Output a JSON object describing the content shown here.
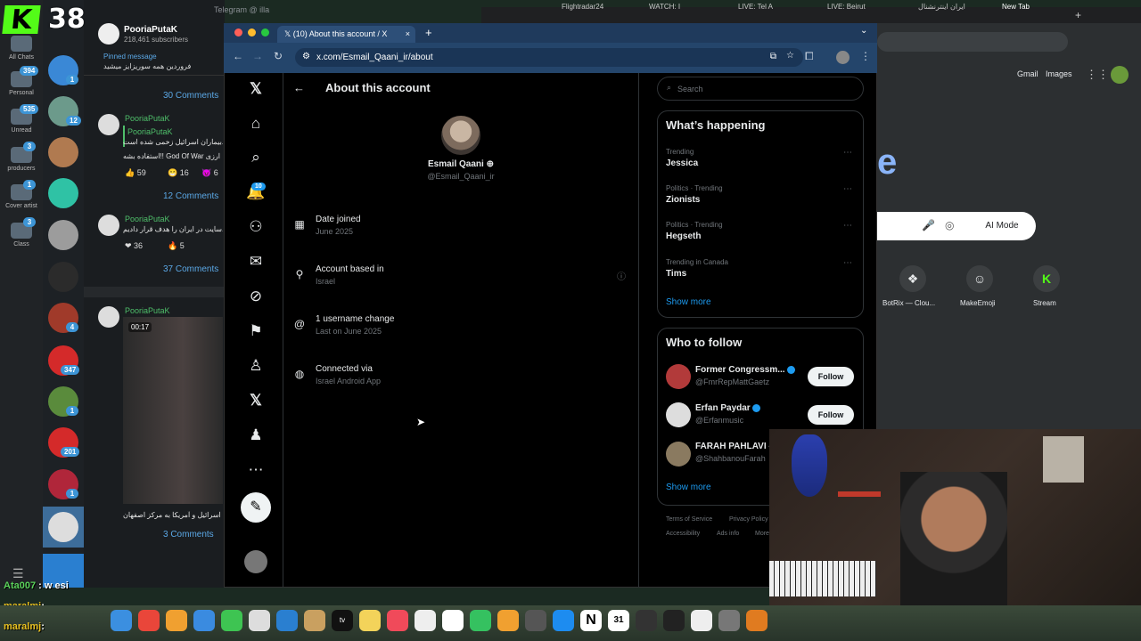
{
  "stream_overlay": {
    "viewer_count": "38"
  },
  "telegram": {
    "window_title": "Telegram @ illa",
    "rail": [
      {
        "label": "All Chats",
        "badge": ""
      },
      {
        "label": "Personal",
        "badge": "394"
      },
      {
        "label": "Unread",
        "badge": "535"
      },
      {
        "label": "producers",
        "badge": "3"
      },
      {
        "label": "Cover artist",
        "badge": "1"
      },
      {
        "label": "Class",
        "badge": "3"
      }
    ],
    "chat_badges": [
      "1",
      "12",
      "4",
      "347",
      "1",
      "201",
      "1"
    ],
    "channel_name": "PooriaPutaK",
    "subscribers": "218,461 subscribers",
    "pinned_label": "Pinned message",
    "pinned_text": "فروردین همه سوریزایز میشید",
    "posts": [
      {
        "author": "PooriaPutaK",
        "comments": "30 Comments"
      },
      {
        "author": "PooriaPutaK",
        "quote_author": "PooriaPutaK",
        "line1": "بیماران اسرائیل زخمی شده است.",
        "line2": "استفاده بشه!! God Of War ارزی",
        "reactions": [
          "59",
          "16",
          "6"
        ],
        "comments": "12 Comments"
      },
      {
        "author": "PooriaPutaK",
        "line1": "سایت در ایران را هدف قرار دادیم.",
        "reactions": [
          "36",
          "5"
        ],
        "comments": "37 Comments"
      },
      {
        "author": "PooriaPutaK",
        "video_time": "00:17",
        "caption": "اسرائیل و آمریکا به مرکز اصفهان",
        "comments": "3 Comments"
      }
    ]
  },
  "browser": {
    "tab_title": "(10) About this account / X",
    "url": "x.com/Esmail_Qaani_ir/about",
    "background_tabs": [
      "Flightradar24",
      "WATCH: I",
      "LIVE: Tel A",
      "LIVE: Beirut",
      "ایران اینترنشنال",
      "New Tab"
    ]
  },
  "x": {
    "nav_notification_count": "10",
    "page_title": "About this account",
    "profile": {
      "name": "Esmail Qaani",
      "handle": "@Esmail_Qaani_ir"
    },
    "info": [
      {
        "title": "Date joined",
        "sub": "June 2025"
      },
      {
        "title": "Account based in",
        "sub": "Israel"
      },
      {
        "title": "1 username change",
        "sub": "Last on June 2025"
      },
      {
        "title": "Connected via",
        "sub": "Israel Android App"
      }
    ],
    "search_placeholder": "Search",
    "whats_happening": "What’s happening",
    "trends": [
      {
        "meta": "Trending",
        "name": "Jessica"
      },
      {
        "meta": "Politics · Trending",
        "name": "Zionists"
      },
      {
        "meta": "Politics · Trending",
        "name": "Hegseth"
      },
      {
        "meta": "Trending in Canada",
        "name": "Tims"
      }
    ],
    "show_more": "Show more",
    "who_to_follow": "Who to follow",
    "follow_suggestions": [
      {
        "name": "Former Congressm...",
        "handle": "@FmrRepMattGaetz",
        "button": "Follow"
      },
      {
        "name": "Erfan Paydar",
        "handle": "@Erfanmusic",
        "button": "Follow"
      },
      {
        "name": "FARAH PAHLAVI -",
        "handle": "@ShahbanouFarah",
        "button": ""
      }
    ],
    "footer": [
      "Terms of Service",
      "Privacy Policy",
      "Accessibility",
      "Ads info",
      "More"
    ]
  },
  "newtab": {
    "gmail": "Gmail",
    "images": "Images",
    "ai_mode": "AI Mode",
    "shortcuts": [
      "BotRix — Clou...",
      "MakeEmoji",
      "Stream"
    ]
  },
  "stream_chat": [
    {
      "user": "Ata007",
      "text": ": w esi",
      "color": "#5ad25a"
    },
    {
      "user": "maralmj",
      "text": ":",
      "color": "#e8c020"
    },
    {
      "user": "maralmj",
      "text": ":",
      "color": "#e8c020"
    }
  ],
  "dock": {
    "calendar_day": "31"
  }
}
